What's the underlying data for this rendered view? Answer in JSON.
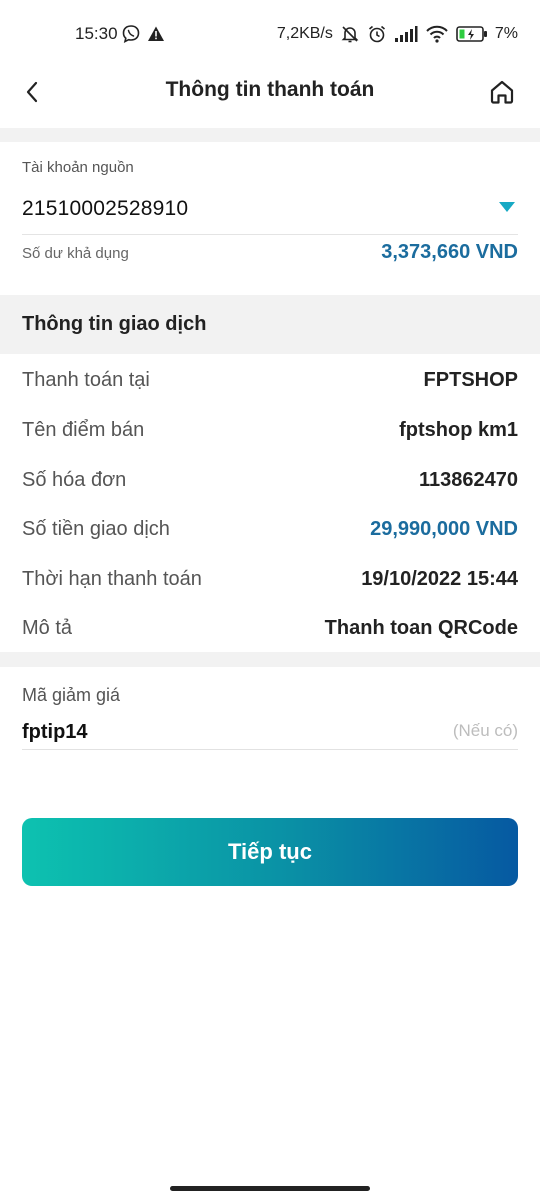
{
  "status_bar": {
    "time": "15:30",
    "network_speed": "7,2KB/s",
    "battery": "7%",
    "icons": [
      "viber-icon",
      "warning-icon",
      "mute-icon",
      "alarm-icon",
      "signal-icon",
      "wifi-icon",
      "battery-icon"
    ]
  },
  "header": {
    "title": "Thông tin thanh toán",
    "back_icon": "chevron-left-icon",
    "home_icon": "home-icon"
  },
  "source_account": {
    "label": "Tài khoản nguồn",
    "account_number": "21510002528910",
    "balance_label": "Số dư khả dụng",
    "balance_value": "3,373,660 VND"
  },
  "transaction": {
    "section_title": "Thông tin giao dịch",
    "rows": [
      {
        "label": "Thanh toán tại",
        "value": "FPTSHOP"
      },
      {
        "label": "Tên điểm bán",
        "value": "fptshop km1"
      },
      {
        "label": "Số hóa đơn",
        "value": "113862470"
      },
      {
        "label": "Số tiền giao dịch",
        "value": "29,990,000 VND"
      },
      {
        "label": "Thời hạn thanh toán",
        "value": "19/10/2022 15:44"
      },
      {
        "label": "Mô tả",
        "value": "Thanh toan QRCode"
      }
    ]
  },
  "discount": {
    "label": "Mã giảm giá",
    "value": "fptip14",
    "hint": "(Nếu có)"
  },
  "actions": {
    "continue_label": "Tiếp tục"
  },
  "colors": {
    "accent_blue": "#1b6c9e",
    "gradient_start": "#0dc2b0",
    "gradient_end": "#0659a2",
    "section_bg": "#f2f2f2"
  }
}
